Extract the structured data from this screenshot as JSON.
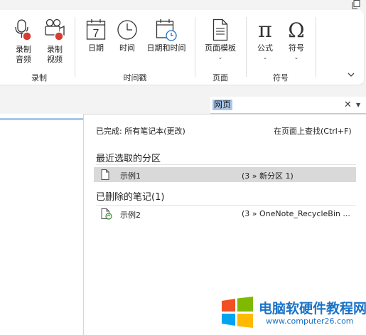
{
  "ribbon": {
    "record": {
      "audio_label_1": "录制",
      "audio_label_2": "音频",
      "video_label_1": "录制",
      "video_label_2": "视频",
      "group_label": "录制"
    },
    "timestamp": {
      "date_label": "日期",
      "time_label": "时间",
      "datetime_label": "日期和时间",
      "group_label": "时间戳"
    },
    "pages": {
      "template_label": "页面模板",
      "group_label": "页面"
    },
    "symbols": {
      "equation_label": "公式",
      "symbol_label": "符号",
      "group_label": "符号"
    },
    "calendar_day": "7"
  },
  "search": {
    "query": "网页"
  },
  "results": {
    "status": "已完成: 所有笔记本(更改)",
    "find_on_page": "在页面上查找(Ctrl+F)",
    "recent_section": "最近选取的分区",
    "recent_items": [
      {
        "name": "示例1",
        "location": "(3 » 新分区 1)"
      }
    ],
    "deleted_section": "已删除的笔记(1)",
    "deleted_items": [
      {
        "name": "示例2",
        "location": "(3 » OneNote_RecycleBin ..."
      }
    ]
  },
  "watermark": {
    "title": "电脑软硬件教程网",
    "url": "www.computer26.com",
    "colors": [
      "#f25022",
      "#7fba00",
      "#00a4ef",
      "#ffb900"
    ]
  },
  "colors": {
    "accent_red": "#d83b2f",
    "selection_gray": "#d9d9d9",
    "search_highlight": "#a9c6ea"
  }
}
